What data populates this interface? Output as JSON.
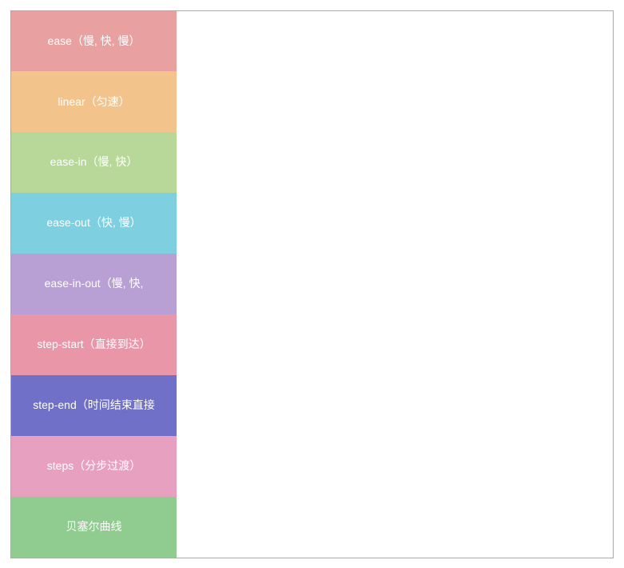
{
  "sidebar": {
    "items": [
      {
        "id": "ease",
        "label": "ease（慢, 快, 慢）",
        "colorClass": "item-ease"
      },
      {
        "id": "linear",
        "label": "linear（匀速）",
        "colorClass": "item-linear"
      },
      {
        "id": "ease-in",
        "label": "ease-in（慢, 快）",
        "colorClass": "item-ease-in"
      },
      {
        "id": "ease-out",
        "label": "ease-out（快, 慢）",
        "colorClass": "item-ease-out"
      },
      {
        "id": "ease-in-out",
        "label": "ease-in-out（慢, 快,",
        "colorClass": "item-ease-in-out"
      },
      {
        "id": "step-start",
        "label": "step-start（直接到达）",
        "colorClass": "item-step-start"
      },
      {
        "id": "step-end",
        "label": "step-end（时间结束直接",
        "colorClass": "item-step-end"
      },
      {
        "id": "steps",
        "label": "steps（分步过渡）",
        "colorClass": "item-steps"
      },
      {
        "id": "bezier",
        "label": "贝塞尔曲线",
        "colorClass": "item-bezier"
      }
    ]
  }
}
